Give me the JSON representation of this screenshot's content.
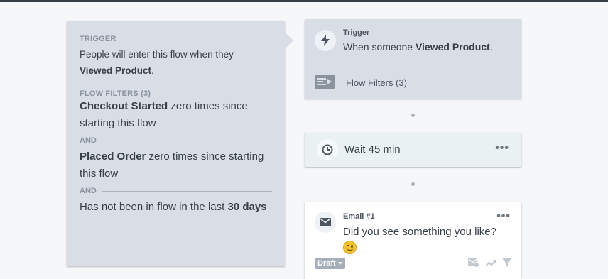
{
  "info_panel": {
    "trigger_label": "TRIGGER",
    "trigger_text_prefix": "People will enter this flow when they",
    "trigger_metric": "Viewed Product",
    "trigger_text_suffix": ".",
    "filters_label": "FLOW FILTERS (3)",
    "and_label": "AND",
    "filters": [
      {
        "bold": "Checkout Started",
        "rest": " zero times since starting this flow"
      },
      {
        "bold": "Placed Order",
        "rest": " zero times since starting this flow"
      },
      {
        "prefix": "Has not been in flow in the last ",
        "bold": "30 days"
      }
    ]
  },
  "trigger_card": {
    "icon": "lightning-icon",
    "kicker": "Trigger",
    "text_prefix": "When someone ",
    "metric": "Viewed Product",
    "text_suffix": ".",
    "filters_icon": "filter-list-icon",
    "filters_link": "Flow Filters (3)"
  },
  "wait_card": {
    "icon": "clock-icon",
    "label": "Wait 45 min",
    "menu_label": "•••"
  },
  "email_card": {
    "icon": "envelope-icon",
    "kicker": "Email #1",
    "subject": "Did you see something you like?",
    "emoji": "winking-face",
    "menu_label": "•••",
    "status": "Draft",
    "tools": [
      "email-check-icon",
      "analytics-icon",
      "filter-icon"
    ]
  },
  "colors": {
    "panel": "#d9dee6",
    "wait_card": "#eaf1f2",
    "connector": "#aab2bc",
    "draft_badge": "#a6afb9",
    "top_bar": "#3a4047"
  }
}
